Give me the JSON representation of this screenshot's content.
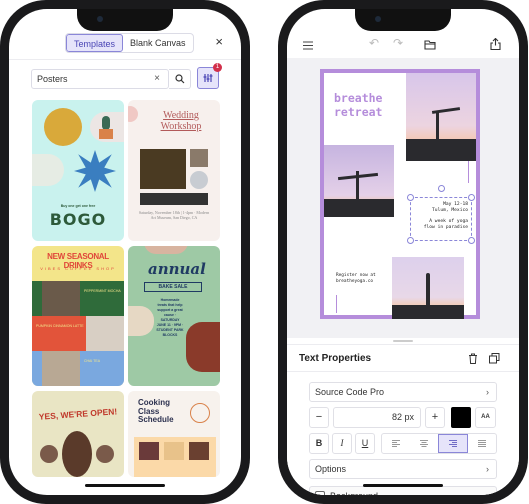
{
  "left": {
    "tabs": [
      {
        "label": "Templates",
        "active": true
      },
      {
        "label": "Blank Canvas",
        "active": false
      }
    ],
    "close_icon": "×",
    "search": {
      "value": "Posters",
      "clear": "×"
    },
    "filter_badge": "1",
    "templates": [
      {
        "title": "BOGO",
        "subtitle": "Buy one get one free",
        "bg": "#c9f2ee",
        "accent": "#2d5a3a"
      },
      {
        "title": "Wedding Workshop",
        "subtitle": "Saturday, November 18th | 1-4pm · Modern Art Museum, San Diego, CA",
        "bg": "#f7f0ed",
        "accent": "#b25a5a"
      },
      {
        "title": "NEW SEASONAL DRINKS",
        "subtitle": "VIBES  COFFEE  SHOP",
        "bg": "#f3e58a",
        "accent": "#e0463a",
        "items": [
          "PEPPERMINT MOCHA",
          "PUMPKIN CINNAMON LATTE",
          "CHAI TEA"
        ]
      },
      {
        "title": "annual",
        "subtitle": "BAKE SALE",
        "details": "Homemade treats that help support a great cause · SATURDAY JUNE 11 · 9PM · STUDENT PARK BLOCKS",
        "bg": "#9ec9a5",
        "accent": "#1f3a63"
      },
      {
        "title": "YES, WE'RE OPEN!",
        "bg": "#e9e5c4",
        "accent": "#c0392b"
      },
      {
        "title": "Cooking Class Schedule",
        "bg": "#f7f2ed",
        "accent": "#2d3250"
      }
    ]
  },
  "right": {
    "toolbar": {
      "menu": "☰",
      "undo": "↶",
      "redo": "↷",
      "folder": "folder",
      "share": "share"
    },
    "poster": {
      "title_line1": "breathe",
      "title_line2": "retreat",
      "dates": "May 12-18",
      "location": "Tulum, Mexico",
      "desc1": "A week of yoga",
      "desc2": "flow in paradise",
      "register1": "Register now at",
      "register2": "breatheyoga.co"
    },
    "panel": {
      "title": "Text Properties",
      "font": "Source Code Pro",
      "size": "82 px",
      "minus": "−",
      "plus": "+",
      "color": "#000000",
      "bold": "B",
      "italic": "I",
      "underline": "U",
      "alignment": "right",
      "options": "Options",
      "background": "Background",
      "chevron": "›"
    }
  }
}
